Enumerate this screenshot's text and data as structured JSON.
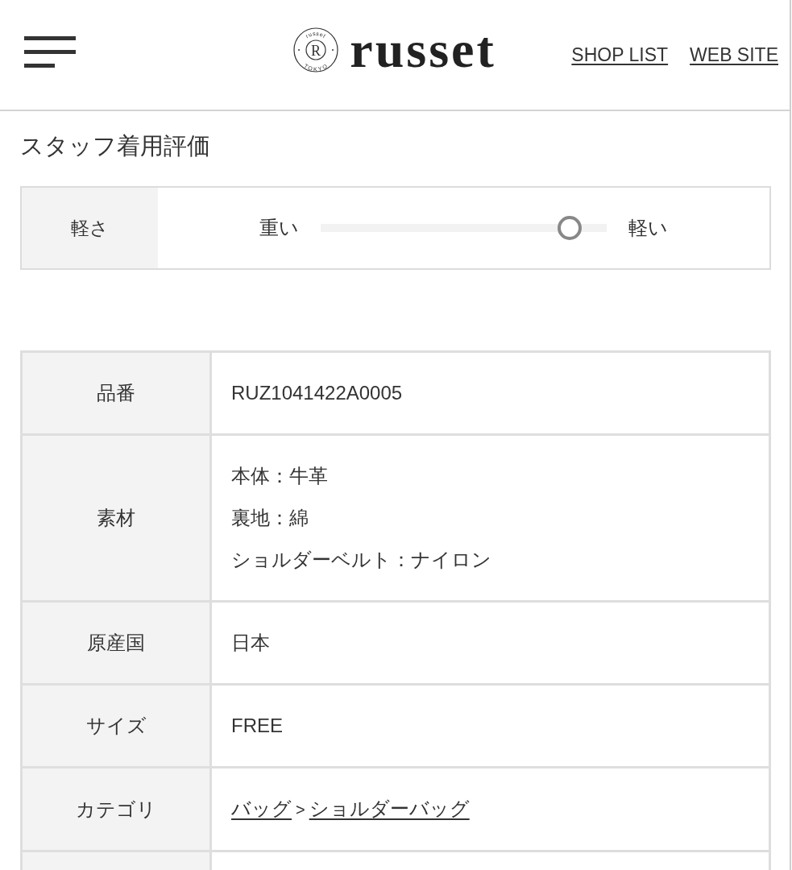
{
  "header": {
    "logo": {
      "emblem_top": "russet",
      "emblem_center": "R",
      "emblem_bottom": "TOKYO",
      "wordmark": "russet"
    },
    "links": [
      "SHOP LIST",
      "WEB SITE"
    ]
  },
  "staff_rating": {
    "title": "スタッフ着用評価",
    "items": [
      {
        "label": "軽さ",
        "min_label": "重い",
        "max_label": "軽い",
        "level": 0.87
      }
    ]
  },
  "spec_table": {
    "rows": [
      {
        "label": "品番",
        "kind": "text",
        "value": "RUZ1041422A0005"
      },
      {
        "label": "素材",
        "kind": "lines",
        "lines": [
          "本体：牛革",
          "裏地：綿",
          "ショルダーベルト：ナイロン"
        ]
      },
      {
        "label": "原産国",
        "kind": "text",
        "value": "日本"
      },
      {
        "label": "サイズ",
        "kind": "text",
        "value": "FREE"
      },
      {
        "label": "カテゴリ",
        "kind": "links",
        "links": [
          "バッグ",
          "ショルダーバッグ"
        ],
        "separator": ">"
      }
    ]
  }
}
